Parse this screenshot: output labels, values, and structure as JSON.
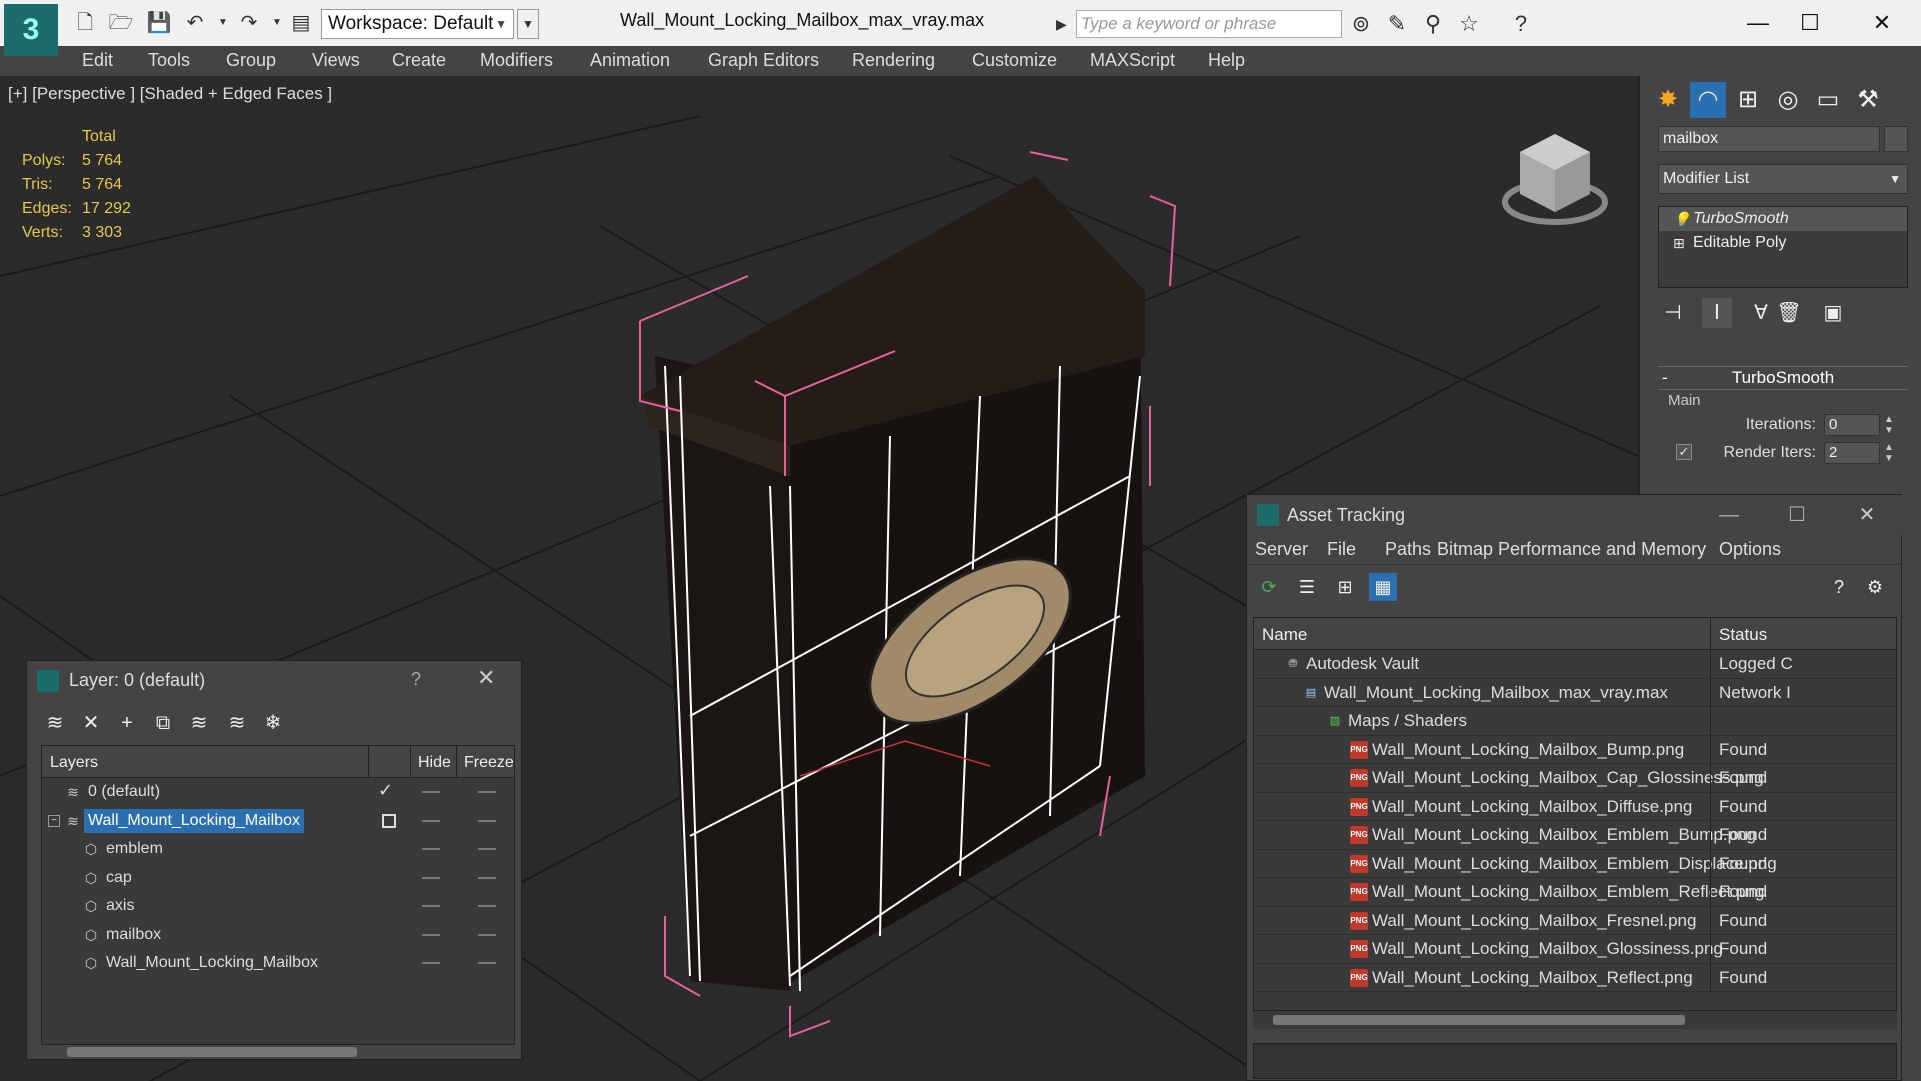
{
  "titlebar": {
    "workspace": "Workspace: Default",
    "file_title": "Wall_Mount_Locking_Mailbox_max_vray.max",
    "search_placeholder": "Type a keyword or phrase",
    "minimize": "—",
    "maximize": "☐",
    "close": "✕"
  },
  "menu": [
    "Edit",
    "Tools",
    "Group",
    "Views",
    "Create",
    "Modifiers",
    "Animation",
    "Graph Editors",
    "Rendering",
    "Customize",
    "MAXScript",
    "Help"
  ],
  "viewport": {
    "label": "[+] [Perspective ] [Shaded + Edged Faces ]",
    "stats_header": "Total",
    "stats": [
      {
        "label": "Polys:",
        "value": "5 764"
      },
      {
        "label": "Tris:",
        "value": "5 764"
      },
      {
        "label": "Edges:",
        "value": "17 292"
      },
      {
        "label": "Verts:",
        "value": "3 303"
      }
    ]
  },
  "command_panel": {
    "object_name": "mailbox",
    "modifier_list": "Modifier List",
    "stack": [
      {
        "label": "TurboSmooth",
        "selected": true
      },
      {
        "label": "Editable Poly",
        "selected": false
      }
    ],
    "rollout_title": "TurboSmooth",
    "group_label": "Main",
    "iterations_label": "Iterations:",
    "iterations_value": "0",
    "render_iters_label": "Render Iters:",
    "render_iters_value": "2"
  },
  "asset_tracking": {
    "title": "Asset Tracking",
    "menu": [
      "Server",
      "File",
      "Paths",
      "Bitmap Performance and Memory",
      "Options"
    ],
    "col_name": "Name",
    "col_status": "Status",
    "rows": [
      {
        "name": "Autodesk Vault",
        "status": "Logged C",
        "level": 0,
        "icon": "vault"
      },
      {
        "name": "Wall_Mount_Locking_Mailbox_max_vray.max",
        "status": "Network I",
        "level": 1,
        "icon": "max"
      },
      {
        "name": "Maps / Shaders",
        "status": "",
        "level": 2,
        "icon": "maps"
      },
      {
        "name": "Wall_Mount_Locking_Mailbox_Bump.png",
        "status": "Found",
        "level": 3,
        "icon": "png"
      },
      {
        "name": "Wall_Mount_Locking_Mailbox_Cap_Glossiness.png",
        "status": "Found",
        "level": 3,
        "icon": "png"
      },
      {
        "name": "Wall_Mount_Locking_Mailbox_Diffuse.png",
        "status": "Found",
        "level": 3,
        "icon": "png"
      },
      {
        "name": "Wall_Mount_Locking_Mailbox_Emblem_Bump.png",
        "status": "Found",
        "level": 3,
        "icon": "png"
      },
      {
        "name": "Wall_Mount_Locking_Mailbox_Emblem_Displace.png",
        "status": "Found",
        "level": 3,
        "icon": "png"
      },
      {
        "name": "Wall_Mount_Locking_Mailbox_Emblem_Reflect.png",
        "status": "Found",
        "level": 3,
        "icon": "png"
      },
      {
        "name": "Wall_Mount_Locking_Mailbox_Fresnel.png",
        "status": "Found",
        "level": 3,
        "icon": "png"
      },
      {
        "name": "Wall_Mount_Locking_Mailbox_Glossiness.png",
        "status": "Found",
        "level": 3,
        "icon": "png"
      },
      {
        "name": "Wall_Mount_Locking_Mailbox_Reflect.png",
        "status": "Found",
        "level": 3,
        "icon": "png"
      }
    ]
  },
  "layer_window": {
    "title": "Layer: 0 (default)",
    "help": "?",
    "close": "✕",
    "col_layers": "Layers",
    "col_hide": "Hide",
    "col_freeze": "Freeze",
    "rows": [
      {
        "name": "0 (default)",
        "level": 0,
        "type": "layer",
        "current": true
      },
      {
        "name": "Wall_Mount_Locking_Mailbox",
        "level": 0,
        "type": "layer",
        "selected": true
      },
      {
        "name": "emblem",
        "level": 1,
        "type": "object"
      },
      {
        "name": "cap",
        "level": 1,
        "type": "object"
      },
      {
        "name": "axis",
        "level": 1,
        "type": "object"
      },
      {
        "name": "mailbox",
        "level": 1,
        "type": "object"
      },
      {
        "name": "Wall_Mount_Locking_Mailbox",
        "level": 1,
        "type": "object"
      }
    ]
  },
  "colors": {
    "accent": "#2b6fb3",
    "stats": "#e8c84a",
    "selection_box": "#e8609a"
  }
}
